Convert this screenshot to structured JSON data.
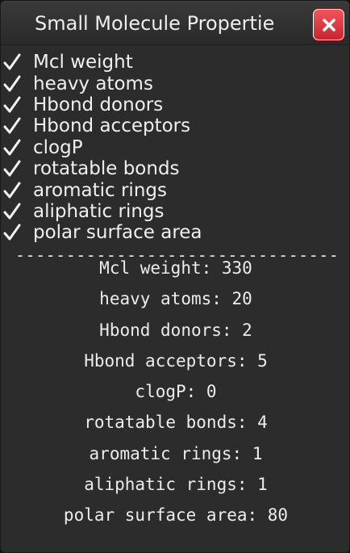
{
  "window": {
    "title": "Small Molecule Propertie"
  },
  "close_icon": "close-icon",
  "options": [
    {
      "label": "Mcl weight",
      "checked": true
    },
    {
      "label": "heavy atoms",
      "checked": true
    },
    {
      "label": "Hbond donors",
      "checked": true
    },
    {
      "label": "Hbond acceptors",
      "checked": true
    },
    {
      "label": "clogP",
      "checked": true
    },
    {
      "label": "rotatable bonds",
      "checked": true
    },
    {
      "label": "aromatic rings",
      "checked": true
    },
    {
      "label": "aliphatic rings",
      "checked": true
    },
    {
      "label": "polar surface area",
      "checked": true
    }
  ],
  "divider": "---------------------------------------",
  "results": [
    "Mcl weight: 330",
    "heavy atoms: 20",
    "Hbond donors: 2",
    "Hbond acceptors: 5",
    "clogP: 0",
    "rotatable bonds: 4",
    "aromatic rings: 1",
    "aliphatic rings: 1",
    "polar surface area: 80"
  ]
}
